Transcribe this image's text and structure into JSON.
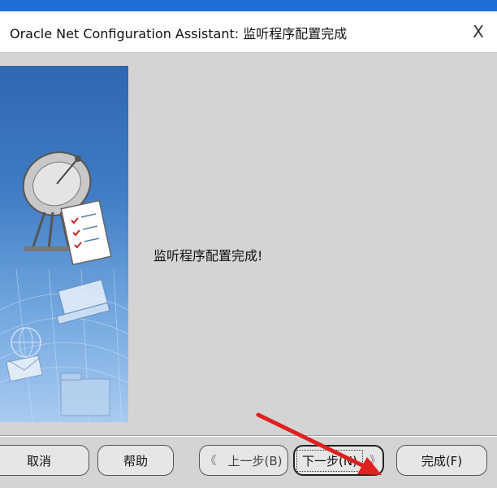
{
  "window": {
    "title": "Oracle Net Configuration Assistant: 监听程序配置完成",
    "close_label": "X"
  },
  "main": {
    "message": "监听程序配置完成!"
  },
  "buttons": {
    "cancel": "取消",
    "help": "帮助",
    "back_chevron": "《",
    "back": "上一步(B)",
    "next": "下一步(N)",
    "next_chevron": "》",
    "finish": "完成(F)"
  },
  "colors": {
    "title_accent": "#1f6fd8",
    "annotation_arrow": "#e02020"
  }
}
